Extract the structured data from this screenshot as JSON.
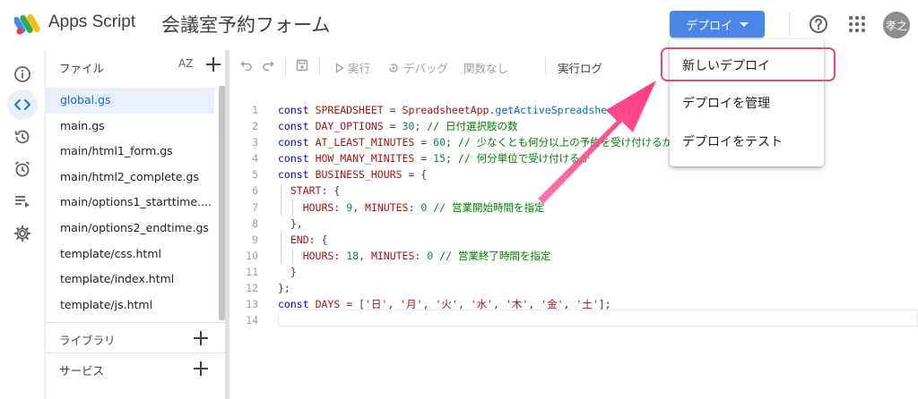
{
  "header": {
    "app_name": "Apps Script",
    "project_title": "会議室予約フォーム",
    "deploy_label": "デプロイ",
    "avatar_text": "孝之"
  },
  "sidebar": {
    "files_title": "ファイル",
    "sort_label": "AZ",
    "files": [
      "global.gs",
      "main.gs",
      "main/html1_form.gs",
      "main/html2_complete.gs",
      "main/options1_starttime....",
      "main/options2_endtime.gs",
      "template/css.html",
      "template/index.html",
      "template/js.html"
    ],
    "active_file": "global.gs",
    "libraries_label": "ライブラリ",
    "services_label": "サービス"
  },
  "toolbar": {
    "run_label": "実行",
    "debug_label": "デバッグ",
    "function_label": "関数なし",
    "log_label": "実行ログ"
  },
  "editor": {
    "line_numbers": [
      "1",
      "2",
      "3",
      "4",
      "5",
      "6",
      "7",
      "8",
      "9",
      "10",
      "11",
      "12",
      "13",
      "14"
    ],
    "current_line": 14
  },
  "menu": {
    "items": [
      "新しいデプロイ",
      "デプロイを管理",
      "デプロイをテスト"
    ],
    "highlighted_item": "新しいデプロイ"
  },
  "colors": {
    "accent": "#4a86e8",
    "highlight": "#e8487f",
    "arrow": "#ff3c8c",
    "active_file_bg": "#e8f0fe"
  }
}
